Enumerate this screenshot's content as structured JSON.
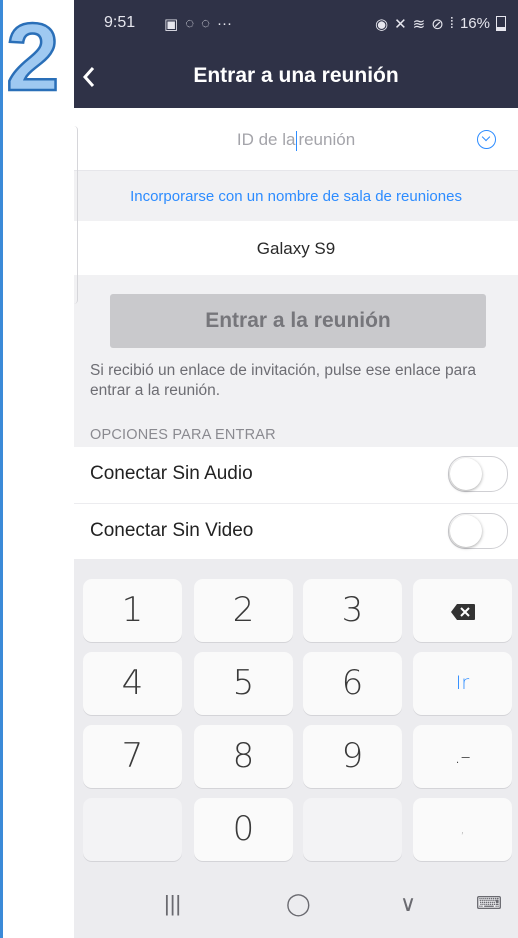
{
  "step_badge": "2",
  "status_bar": {
    "time": "9:51",
    "left_icons": [
      "gallery-icon",
      "whatsapp-icon",
      "whatsapp-icon",
      "more-icon"
    ],
    "more": "···",
    "right_icons": [
      "alarm-icon",
      "mute-icon",
      "wifi-icon",
      "blocked-icon",
      "signal-icon"
    ],
    "battery": "16%"
  },
  "header": {
    "back": "<",
    "title": "Entrar a una reunión"
  },
  "form": {
    "meeting_id_placeholder_a": "ID de la",
    "meeting_id_placeholder_b": "reunión",
    "room_link": "Incorporarse con un nombre de sala de reuniones",
    "display_name": "Galaxy S9",
    "join_button": "Entrar a la reunión",
    "hint": "Si recibió un enlace de invitación, pulse ese enlace para entrar a la reunión.",
    "options_header": "OPCIONES PARA ENTRAR",
    "options": [
      {
        "label": "Conectar Sin Audio",
        "on": false
      },
      {
        "label": "Conectar Sin Video",
        "on": false
      }
    ]
  },
  "keypad": {
    "keys": [
      "1",
      "2",
      "3",
      "⌫",
      "4",
      "5",
      "6",
      "Ir",
      "7",
      "8",
      "9",
      ".–",
      "",
      "0",
      "",
      ","
    ]
  },
  "navbar": {
    "recents": "|||",
    "home": "◯",
    "back": "∨",
    "keyboard": "⌨"
  },
  "colors": {
    "header_bg": "#2f3247",
    "accent": "#2d8cff",
    "step_badge": "#3b8ad8"
  }
}
